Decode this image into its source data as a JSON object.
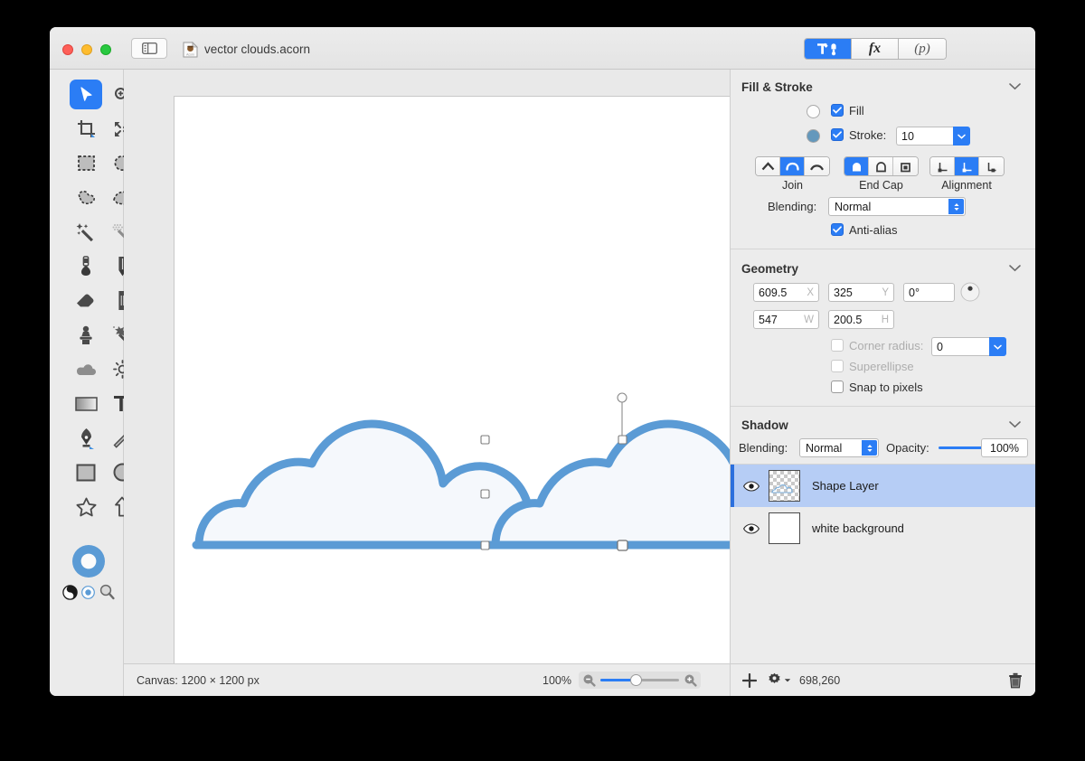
{
  "window": {
    "title": "vector clouds.acorn",
    "doc_icon": "acorn-document-icon",
    "sidebar_toggle_icon": "sidebar-toggle-icon",
    "traffic_lights": [
      "close-button",
      "minimize-button",
      "zoom-button"
    ]
  },
  "inspector_tabs": [
    {
      "id": "tools",
      "icon": "hammer-tools-icon",
      "active": true
    },
    {
      "id": "effects",
      "label": "fx",
      "active": false
    },
    {
      "id": "presets",
      "label": "(p)",
      "active": false
    }
  ],
  "tools": [
    {
      "name": "move-tool",
      "icon": "arrow-cursor-icon",
      "selected": true
    },
    {
      "name": "zoom-tool",
      "icon": "magnifier-plus-icon",
      "selected": false
    },
    {
      "name": "crop-tool",
      "icon": "crop-icon",
      "selected": false
    },
    {
      "name": "transform-tool",
      "icon": "four-arrows-icon",
      "selected": false
    },
    {
      "name": "rectangular-select-tool",
      "icon": "dashed-rectangle-icon",
      "selected": false
    },
    {
      "name": "elliptical-select-tool",
      "icon": "dashed-ellipse-icon",
      "selected": false
    },
    {
      "name": "lasso-select-tool",
      "icon": "dashed-blob-icon",
      "selected": false
    },
    {
      "name": "polygon-select-tool",
      "icon": "dashed-polygon-icon",
      "selected": false
    },
    {
      "name": "magic-wand-tool",
      "icon": "magic-wand-icon",
      "selected": false
    },
    {
      "name": "magic-wand-soft-tool",
      "icon": "magic-wand-dither-icon",
      "selected": false
    },
    {
      "name": "bloom-tool",
      "icon": "bulb-brush-icon",
      "selected": false
    },
    {
      "name": "pencil-tool",
      "icon": "pencil-icon",
      "selected": false
    },
    {
      "name": "eraser-tool",
      "icon": "eraser-icon",
      "selected": false
    },
    {
      "name": "smudge-tool",
      "icon": "smudge-bar-icon",
      "selected": false
    },
    {
      "name": "clone-stamp-tool",
      "icon": "stamp-icon",
      "selected": false
    },
    {
      "name": "spatter-tool",
      "icon": "spatter-icon",
      "selected": false
    },
    {
      "name": "cloud-tool",
      "icon": "cloud-icon",
      "selected": false
    },
    {
      "name": "brightness-tool",
      "icon": "sun-icon",
      "selected": false
    },
    {
      "name": "gradient-tool",
      "icon": "gradient-rect-icon",
      "selected": false
    },
    {
      "name": "text-tool",
      "icon": "text-t-icon",
      "selected": false
    },
    {
      "name": "bezier-pen-tool",
      "icon": "fountain-pen-icon",
      "selected": false
    },
    {
      "name": "line-tool",
      "icon": "line-icon",
      "selected": false
    },
    {
      "name": "rectangle-shape-tool",
      "icon": "rectangle-icon",
      "selected": false
    },
    {
      "name": "ellipse-shape-tool",
      "icon": "circle-icon",
      "selected": false
    },
    {
      "name": "star-shape-tool",
      "icon": "star-icon",
      "selected": false
    },
    {
      "name": "arrow-shape-tool",
      "icon": "arrow-up-icon",
      "selected": false
    }
  ],
  "color_well": {
    "name": "foreground-color-well",
    "color": "#5b9bd5",
    "inner": "#ffffff",
    "extras": [
      {
        "name": "contrast-toggle-icon"
      },
      {
        "name": "color-target-icon"
      },
      {
        "name": "color-picker-magnifier-icon"
      }
    ]
  },
  "canvas": {
    "background": "#ffffff",
    "shapes": [
      {
        "name": "cloud-shape-left",
        "selected": false,
        "fill": "#f5f8fc",
        "stroke": "#5b9bd5",
        "stroke_width": 10
      },
      {
        "name": "cloud-shape-right",
        "selected": true,
        "fill": "#f5f8fc",
        "stroke": "#5b9bd5",
        "stroke_width": 10
      }
    ],
    "selection_handles": 8,
    "rotation_handle": true
  },
  "fill_stroke": {
    "title": "Fill & Stroke",
    "fill": {
      "label": "Fill",
      "checked": true,
      "color": "#fdfdfd"
    },
    "stroke": {
      "label": "Stroke:",
      "checked": true,
      "color": "#6498bc",
      "width": "10"
    },
    "join": {
      "caption": "Join",
      "options": [
        {
          "name": "join-miter",
          "icon": "miter-join-icon",
          "active": false
        },
        {
          "name": "join-round",
          "icon": "round-join-icon",
          "active": true
        },
        {
          "name": "join-bevel",
          "icon": "bevel-join-icon",
          "active": false
        }
      ]
    },
    "end_cap": {
      "caption": "End Cap",
      "options": [
        {
          "name": "cap-round",
          "icon": "round-cap-icon",
          "active": true
        },
        {
          "name": "cap-butt",
          "icon": "butt-cap-icon",
          "active": false
        },
        {
          "name": "cap-square",
          "icon": "square-cap-icon",
          "active": false
        }
      ]
    },
    "alignment": {
      "caption": "Alignment",
      "options": [
        {
          "name": "align-inside",
          "icon": "align-inside-icon",
          "active": false
        },
        {
          "name": "align-center",
          "icon": "align-center-icon",
          "active": true
        },
        {
          "name": "align-outside",
          "icon": "align-outside-icon",
          "active": false
        }
      ]
    },
    "blending": {
      "label": "Blending:",
      "value": "Normal"
    },
    "antialias": {
      "label": "Anti-alias",
      "checked": true
    }
  },
  "geometry": {
    "title": "Geometry",
    "x": {
      "value": "609.5",
      "unit": "X"
    },
    "y": {
      "value": "325",
      "unit": "Y"
    },
    "rotation": {
      "value": "0°"
    },
    "w": {
      "value": "547",
      "unit": "W"
    },
    "h": {
      "value": "200.5",
      "unit": "H"
    },
    "corner_radius": {
      "label": "Corner radius:",
      "checked": false,
      "value": "0",
      "enabled": false
    },
    "superellipse": {
      "label": "Superellipse",
      "checked": false,
      "enabled": false
    },
    "snap_to_pixels": {
      "label": "Snap to pixels",
      "checked": false,
      "enabled": true
    }
  },
  "shadow": {
    "title": "Shadow",
    "blending": {
      "label": "Blending:",
      "value": "Normal"
    },
    "opacity": {
      "label": "Opacity:",
      "value": "100%",
      "percent": 100
    }
  },
  "layers": [
    {
      "name": "Shape Layer",
      "visible": true,
      "selected": true,
      "thumb": "transparent-cloud-thumb"
    },
    {
      "name": "white background",
      "visible": true,
      "selected": false,
      "thumb": "white-thumb"
    }
  ],
  "status_bar": {
    "canvas_info": "Canvas: 1200 × 1200 px",
    "zoom": "100%",
    "zoom_percent": 45,
    "zoom_out_icon": "magnifier-minus-icon",
    "zoom_in_icon": "magnifier-plus-icon"
  },
  "layer_toolbar": {
    "add_icon": "plus-icon",
    "settings_icon": "gear-dropdown-icon",
    "memory": "698,260",
    "delete_icon": "trash-icon"
  }
}
